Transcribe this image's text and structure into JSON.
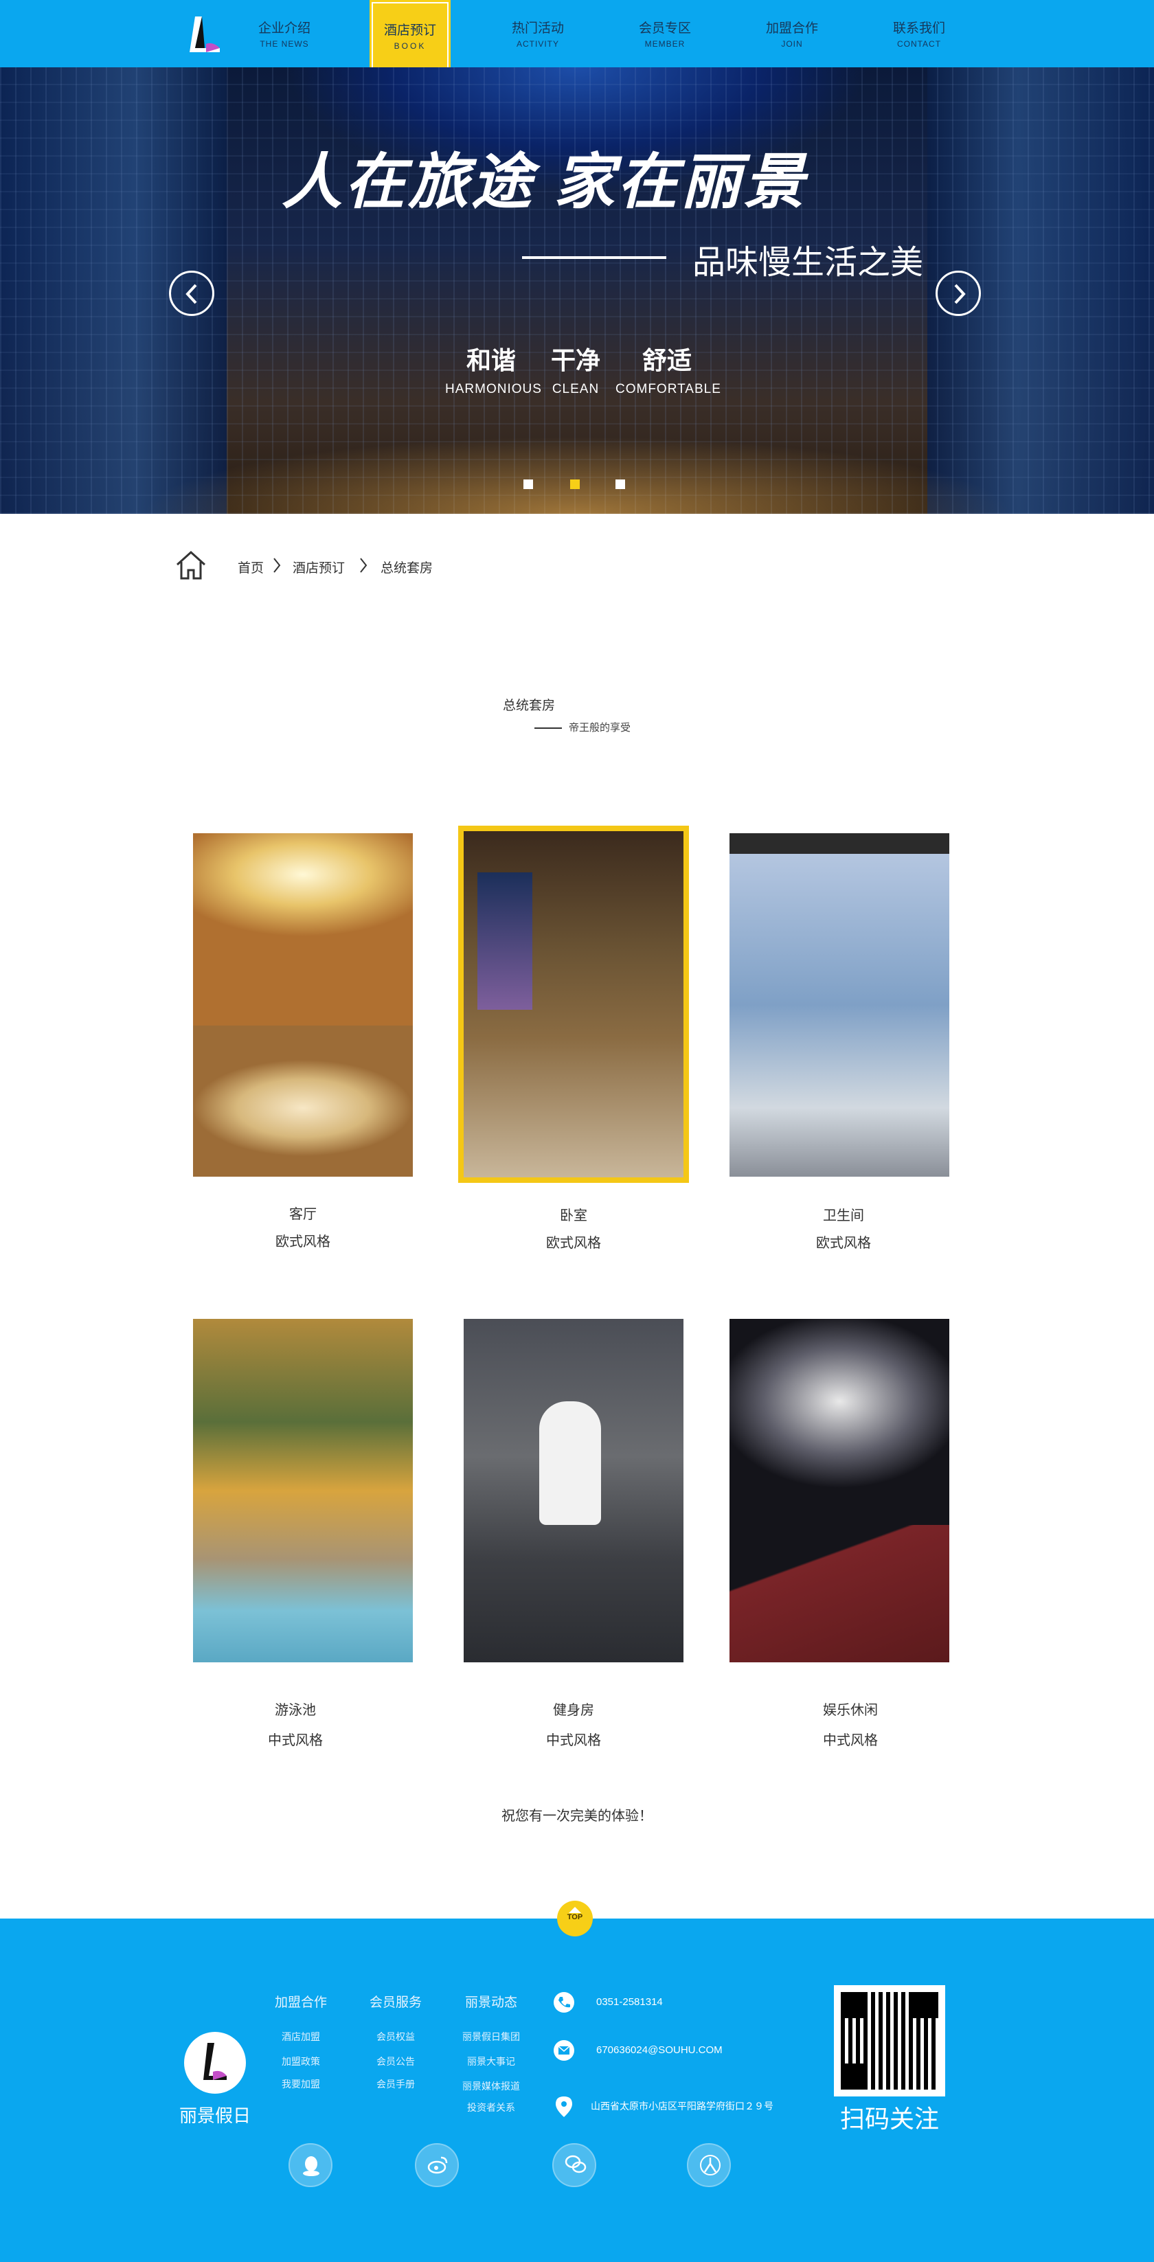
{
  "nav": {
    "items": [
      {
        "zh": "企业介绍",
        "en": "THE NEWS"
      },
      {
        "zh": "酒店预订",
        "en": "BOOK"
      },
      {
        "zh": "热门活动",
        "en": "ACTIVITY"
      },
      {
        "zh": "会员专区",
        "en": "MEMBER"
      },
      {
        "zh": "加盟合作",
        "en": "JOIN"
      },
      {
        "zh": "联系我们",
        "en": "CONTACT"
      }
    ],
    "active_index": 1,
    "brand_color": "#0aa7ef",
    "accent_color": "#f7cf17"
  },
  "hero": {
    "title": "人在旅途  家在丽景",
    "subtitle": "品味慢生活之美",
    "keywords": [
      {
        "zh": "和谐",
        "en": "HARMONIOUS"
      },
      {
        "zh": "干净",
        "en": "CLEAN"
      },
      {
        "zh": "舒适",
        "en": "COMFORTABLE"
      }
    ],
    "slide_count": 3,
    "active_slide": 2,
    "prev_icon": "chevron-left-icon",
    "next_icon": "chevron-right-icon"
  },
  "breadcrumb": {
    "icon": "home-icon",
    "items": [
      "首页",
      "酒店预订",
      "总统套房"
    ]
  },
  "section": {
    "title": "总统套房",
    "subtitle": "帝王般的享受"
  },
  "rooms": [
    {
      "name": "客厅",
      "style": "欧式风格"
    },
    {
      "name": "卧室",
      "style": "欧式风格"
    },
    {
      "name": "卫生间",
      "style": "欧式风格"
    },
    {
      "name": "游泳池",
      "style": "中式风格"
    },
    {
      "name": "健身房",
      "style": "中式风格"
    },
    {
      "name": "娱乐休闲",
      "style": "中式风格"
    }
  ],
  "wish": "祝您有一次完美的体验！",
  "footer": {
    "top_label": "TOP",
    "brand": "丽景假日",
    "columns": [
      {
        "heading": "加盟合作",
        "items": [
          "酒店加盟",
          "加盟政策",
          "我要加盟"
        ]
      },
      {
        "heading": "会员服务",
        "items": [
          "会员权益",
          "会员公告",
          "会员手册"
        ]
      },
      {
        "heading": "丽景动态",
        "items": [
          "丽景假日集团",
          "丽景大事记",
          "丽景媒体报道",
          "投资者关系"
        ]
      }
    ],
    "contacts": [
      {
        "icon": "phone-icon",
        "text": "0351-2581314"
      },
      {
        "icon": "mail-icon",
        "text": "670636024@SOUHU.COM"
      },
      {
        "icon": "location-icon",
        "text": "山西省太原市小店区平阳路学府街口２９号"
      }
    ],
    "qr_label": "扫码关注",
    "social": [
      "qq-icon",
      "weibo-icon",
      "wechat-icon",
      "renren-icon"
    ]
  }
}
